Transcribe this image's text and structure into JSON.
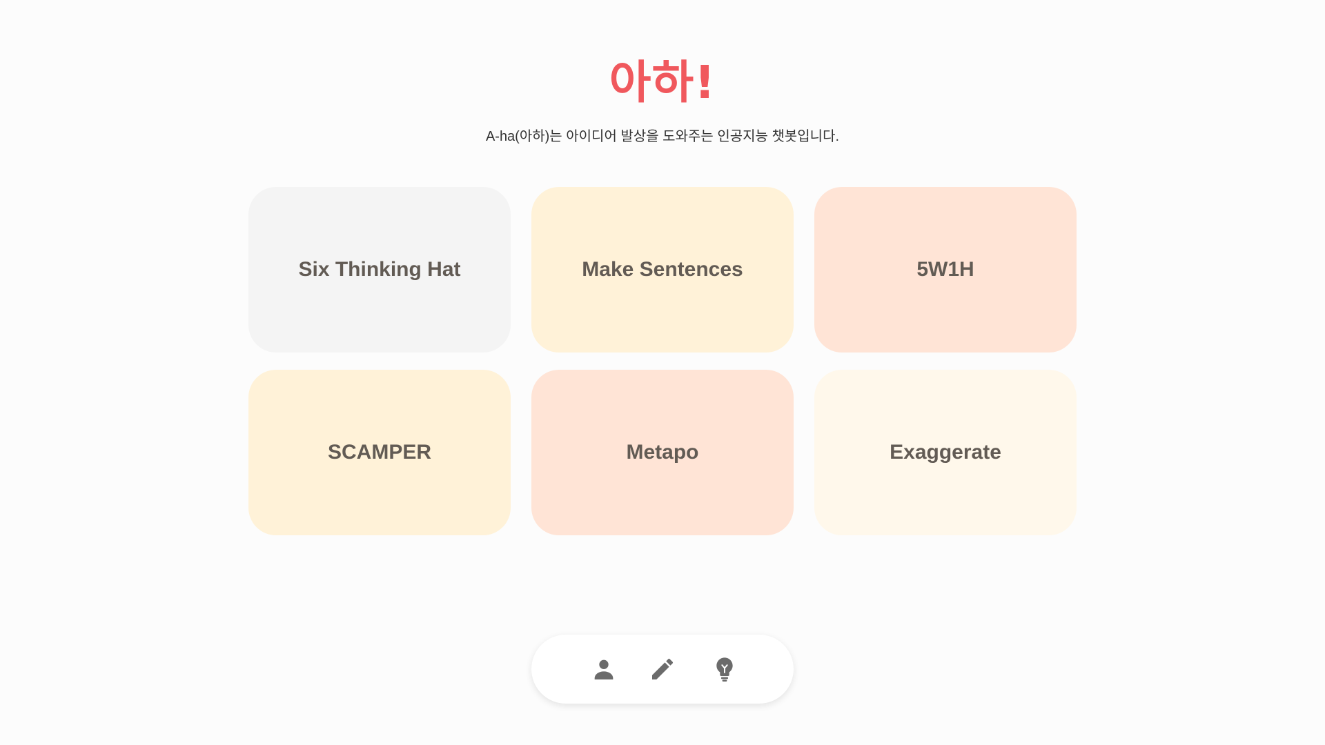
{
  "header": {
    "title": "아하!",
    "subtitle": "A-ha(아하)는 아이디어 발상을 도와주는 인공지능 챗봇입니다."
  },
  "cards": [
    {
      "label": "Six Thinking Hat",
      "color": "#f4f4f4"
    },
    {
      "label": "Make Sentences",
      "color": "#fff2d8"
    },
    {
      "label": "5W1H",
      "color": "#ffe4d6"
    },
    {
      "label": "SCAMPER",
      "color": "#fff2d8"
    },
    {
      "label": "Metapo",
      "color": "#ffe4d6"
    },
    {
      "label": "Exaggerate",
      "color": "#fff8eb"
    }
  ],
  "nav": {
    "items": [
      {
        "icon": "person-icon"
      },
      {
        "icon": "pencil-icon"
      },
      {
        "icon": "lightbulb-icon"
      }
    ]
  },
  "colors": {
    "accent": "#f0585d",
    "background": "#fcfcfc",
    "card_text": "#625b54",
    "icon": "#6b6b6b"
  }
}
